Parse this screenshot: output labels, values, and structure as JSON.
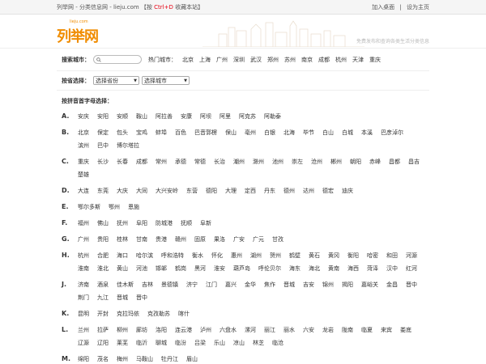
{
  "topbar": {
    "left_prefix": "列举网 - 分类信息网 - lieju.com 【按 ",
    "shortcut": "Ctrl+D",
    "left_suffix": " 收藏本站】",
    "links": [
      "加入桌面",
      "设为主页"
    ],
    "separator": "|"
  },
  "header": {
    "logo_domain": "lieju.com",
    "logo_name": "列举网",
    "slogan": "免费发布和查询各类生活分类信息"
  },
  "search": {
    "label": "搜索城市：",
    "placeholder": "",
    "hot_label": "热门城市：",
    "hot_cities": [
      "北京",
      "上海",
      "广州",
      "深圳",
      "武汉",
      "郑州",
      "苏州",
      "南京",
      "成都",
      "杭州",
      "天津",
      "重庆"
    ]
  },
  "province": {
    "label": "按省选择：",
    "province_select": "选择省份",
    "city_select": "选择城市"
  },
  "pinyin": {
    "title": "按拼音首字母选择：",
    "groups": [
      {
        "letter": "A.",
        "cities": [
          "安庆",
          "安阳",
          "安顺",
          "鞍山",
          "阿拉善",
          "安康",
          "阿坝",
          "阿里",
          "阿克苏",
          "阿勒泰"
        ]
      },
      {
        "letter": "B.",
        "cities": [
          "北京",
          "保定",
          "包头",
          "宝鸡",
          "蚌埠",
          "百色",
          "巴音郭楞",
          "保山",
          "亳州",
          "白银",
          "北海",
          "毕节",
          "白山",
          "白城",
          "本溪",
          "巴彦淖尔",
          "滨州",
          "巴中",
          "博尔塔拉"
        ]
      },
      {
        "letter": "C.",
        "cities": [
          "重庆",
          "长沙",
          "长春",
          "成都",
          "常州",
          "承德",
          "常德",
          "长治",
          "潮州",
          "滁州",
          "池州",
          "崇左",
          "沧州",
          "郴州",
          "朝阳",
          "赤峰",
          "昌都",
          "昌吉",
          "楚雄"
        ]
      },
      {
        "letter": "D.",
        "cities": [
          "大连",
          "东莞",
          "大庆",
          "大同",
          "大兴安岭",
          "东营",
          "德阳",
          "大理",
          "定西",
          "丹东",
          "德州",
          "达州",
          "德宏",
          "迪庆"
        ]
      },
      {
        "letter": "E.",
        "cities": [
          "鄂尔多斯",
          "鄂州",
          "恩施"
        ]
      },
      {
        "letter": "F.",
        "cities": [
          "福州",
          "佛山",
          "抚州",
          "阜阳",
          "防城港",
          "抚顺",
          "阜新"
        ]
      },
      {
        "letter": "G.",
        "cities": [
          "广州",
          "贵阳",
          "桂林",
          "甘南",
          "贵港",
          "赣州",
          "固原",
          "果洛",
          "广安",
          "广元",
          "甘孜"
        ]
      },
      {
        "letter": "H.",
        "cities": [
          "杭州",
          "合肥",
          "海口",
          "哈尔滨",
          "呼和浩特",
          "衡水",
          "怀化",
          "惠州",
          "湖州",
          "贺州",
          "鹤壁",
          "黄石",
          "黄冈",
          "衡阳",
          "哈密",
          "和田",
          "河源",
          "淮南",
          "淮北",
          "黄山",
          "河池",
          "邯郸",
          "鹤岗",
          "黑河",
          "淮安",
          "葫芦岛",
          "呼伦贝尔",
          "海东",
          "海北",
          "黄南",
          "海西",
          "菏泽",
          "汉中",
          "红河"
        ]
      },
      {
        "letter": "J.",
        "cities": [
          "济南",
          "酒泉",
          "佳木斯",
          "吉林",
          "景德镇",
          "济宁",
          "江门",
          "嘉兴",
          "金华",
          "焦作",
          "晋城",
          "吉安",
          "锦州",
          "揭阳",
          "嘉峪关",
          "金昌",
          "晋中",
          "荆门",
          "九江",
          "晋城",
          "晋中"
        ]
      },
      {
        "letter": "K.",
        "cities": [
          "昆明",
          "开封",
          "克拉玛依",
          "克孜勒苏",
          "喀什"
        ]
      },
      {
        "letter": "L.",
        "cities": [
          "兰州",
          "拉萨",
          "柳州",
          "廊坊",
          "洛阳",
          "连云港",
          "泸州",
          "六盘水",
          "漯河",
          "丽江",
          "丽水",
          "六安",
          "龙岩",
          "陇南",
          "临夏",
          "来宾",
          "娄底",
          "辽源",
          "辽阳",
          "莱芜",
          "临沂",
          "聊城",
          "临汾",
          "吕梁",
          "乐山",
          "凉山",
          "林芝",
          "临沧"
        ]
      },
      {
        "letter": "M.",
        "cities": [
          "绵阳",
          "茂名",
          "梅州",
          "马鞍山",
          "牡丹江",
          "眉山"
        ]
      }
    ]
  }
}
